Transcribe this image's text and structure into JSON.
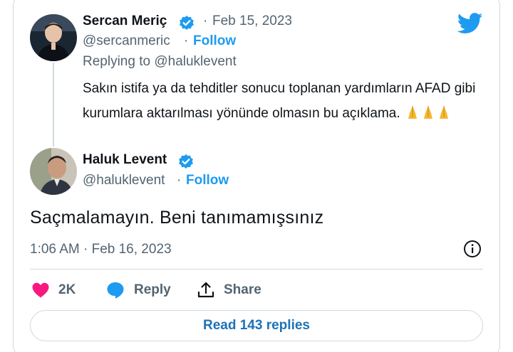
{
  "reply_tweet": {
    "author_name": "Sercan Meriç",
    "separator": "·",
    "date": "Feb 15, 2023",
    "handle": "@sercanmeric",
    "handle_separator": "·",
    "follow_label": "Follow",
    "replying_to": "Replying to @haluklevent",
    "text": "Sakın istifa ya da tehditler sonucu toplanan yardımların AFAD gibi kurumlara aktarılması yönünde olmasın bu açıklama.",
    "emoji_icons": [
      "folded-hands-icon",
      "folded-hands-icon",
      "folded-hands-icon"
    ]
  },
  "main_tweet": {
    "author_name": "Haluk Levent",
    "handle": "@haluklevent",
    "handle_separator": "·",
    "follow_label": "Follow",
    "text": "Saçmalamayın. Beni tanımamışsınız",
    "timestamp": "1:06 AM · Feb 16, 2023"
  },
  "actions": {
    "like_count": "2K",
    "reply_label": "Reply",
    "share_label": "Share"
  },
  "read_replies_label": "Read 143 replies",
  "colors": {
    "twitter_blue": "#1d9bf0",
    "like_red": "#f91880",
    "text_muted": "#536471",
    "border": "#cfd9de"
  },
  "icons": [
    "twitter-bird-icon",
    "verified-badge-icon",
    "info-icon",
    "heart-icon",
    "reply-bubble-icon",
    "share-icon"
  ]
}
